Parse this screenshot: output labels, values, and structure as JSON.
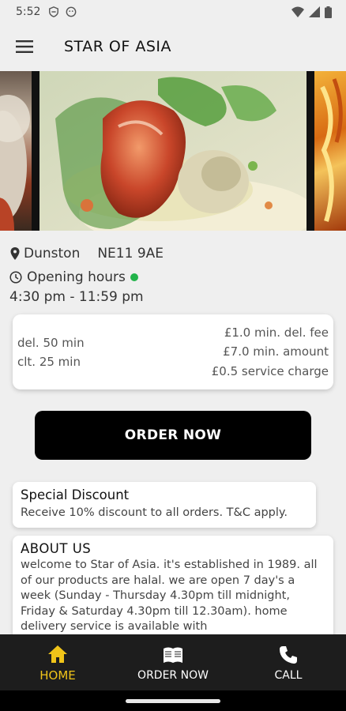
{
  "status_bar": {
    "time": "5:52"
  },
  "app_bar": {
    "title": "STAR OF ASIA"
  },
  "location": {
    "area": "Dunston",
    "postcode": "NE11 9AE"
  },
  "hours": {
    "label": "Opening hours",
    "time": "4:30 pm - 11:59 pm",
    "status_color": "#22b34a"
  },
  "delivery": {
    "delivery_time": "del. 50 min",
    "collection_time": "clt. 25 min",
    "min_delivery_fee": "£1.0 min. del. fee",
    "min_amount": "£7.0 min. amount",
    "service_charge": "£0.5 service charge"
  },
  "order_button": {
    "label": "ORDER NOW"
  },
  "discount": {
    "title": "Special Discount",
    "text": "Receive 10% discount to all orders. T&C apply."
  },
  "about": {
    "title": "ABOUT US",
    "text": "welcome to Star of Asia. it's established in 1989. all of our products are halal. we are open 7 day's a week (Sunday - Thursday 4.30pm till midnight, Friday & Saturday 4.30pm till 12.30am). home delivery service is available with"
  },
  "bottom_nav": {
    "items": [
      {
        "label": "HOME",
        "icon": "home-icon",
        "active": true
      },
      {
        "label": "ORDER NOW",
        "icon": "menu-book-icon",
        "active": false
      },
      {
        "label": "CALL",
        "icon": "phone-icon",
        "active": false
      }
    ]
  },
  "colors": {
    "accent": "#f0c419",
    "nav_bg": "#1d1d1d",
    "button_bg": "#000000"
  }
}
